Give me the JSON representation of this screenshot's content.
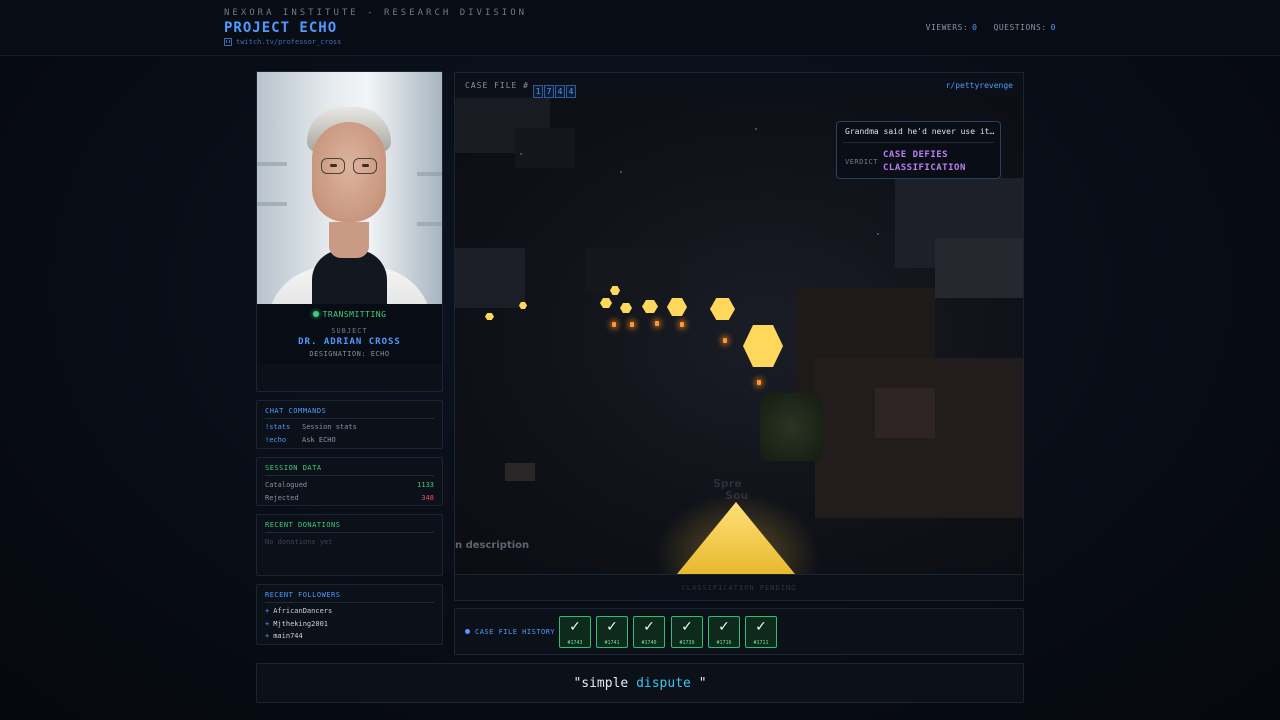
{
  "header": {
    "org": "NEXORA INSTITUTE - RESEARCH DIVISION",
    "title": "PROJECT ECHO",
    "channel": "twitch.tv/professor_cross",
    "viewers_label": "VIEWERS:",
    "viewers_value": "0",
    "questions_label": "QUESTIONS:",
    "questions_value": "0"
  },
  "subject": {
    "status": "TRANSMITTING",
    "label": "SUBJECT",
    "name": "DR. ADRIAN CROSS",
    "designation": "DESIGNATION: ECHO"
  },
  "chat_commands": {
    "title": "CHAT COMMANDS",
    "items": [
      {
        "cmd": "!stats",
        "desc": "Session stats"
      },
      {
        "cmd": "!echo",
        "desc": "Ask ECHO"
      }
    ]
  },
  "session_data": {
    "title": "SESSION DATA",
    "catalogued_label": "Catalogued",
    "catalogued_value": "1133",
    "rejected_label": "Rejected",
    "rejected_value": "348"
  },
  "donations": {
    "title": "RECENT DONATIONS",
    "empty": "No donations yet"
  },
  "followers": {
    "title": "RECENT FOLLOWERS",
    "items": [
      "AfricanDancers",
      "Mjtheking2001",
      "main744"
    ]
  },
  "case": {
    "label": "CASE FILE #",
    "digits": [
      "1",
      "7",
      "4",
      "4"
    ],
    "subreddit": "r/pettyrevenge",
    "quote": "Grandma said he'd never use it…",
    "verdict_label": "VERDICT",
    "verdict_line1": "CASE DEFIES",
    "verdict_line2": "CLASSIFICATION",
    "scene_caption": "n description",
    "sign_line1": "Spre",
    "sign_line2": "Sou",
    "pending": "CLASSIFICATION PENDING"
  },
  "history": {
    "label": "CASE FILE HISTORY",
    "items": [
      {
        "check": "✓",
        "num": "#1743"
      },
      {
        "check": "✓",
        "num": "#1741"
      },
      {
        "check": "✓",
        "num": "#1740"
      },
      {
        "check": "✓",
        "num": "#1739"
      },
      {
        "check": "✓",
        "num": "#1716"
      },
      {
        "check": "✓",
        "num": "#1711"
      }
    ]
  },
  "bottom_quote": {
    "open": "\"simple ",
    "highlight": "dispute",
    "close": " \""
  }
}
